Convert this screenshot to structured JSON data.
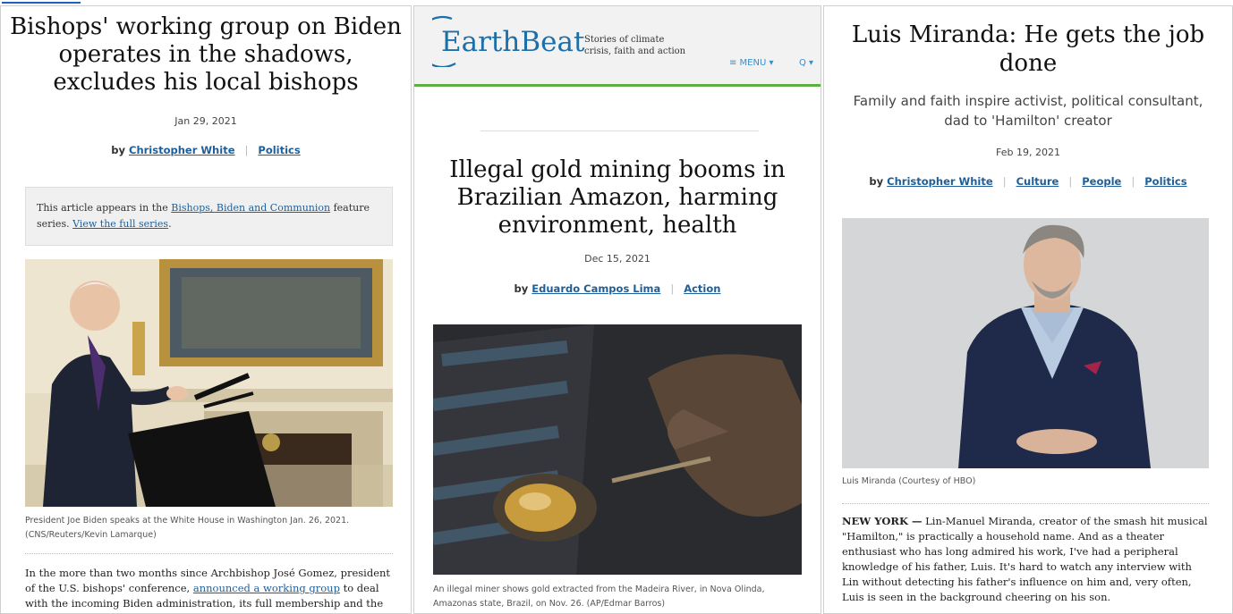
{
  "article1": {
    "headline": "Bishops' working group on Biden operates in the shadows, excludes his local bishops",
    "date": "Jan 29, 2021",
    "by_prefix": "by",
    "author": "Christopher White",
    "sep": "|",
    "category": "Politics",
    "series_text_1": "This article appears in the",
    "series_link": "Bishops, Biden and Communion",
    "series_text_2": "feature series.",
    "view_series": "View the full series",
    "series_period": ".",
    "caption": "President Joe Biden speaks at the White House in Washington Jan. 26, 2021. (CNS/Reuters/Kevin Lamarque)",
    "body_1": "In the more than two months since Archbishop José Gomez, president of the U.S. bishops' conference,",
    "body_link": "announced a working group",
    "body_2": "to deal with the incoming Biden administration, its full membership and the scope of its"
  },
  "article2": {
    "logo_text": "EarthBeat",
    "tagline_1": "Stories of climate",
    "tagline_2": "crisis, faith and action",
    "menu_label": "≡ MENU ▾",
    "search_label": "Q ▾",
    "headline": "Illegal gold mining booms in Brazilian Amazon, harming environment, health",
    "date": "Dec 15, 2021",
    "by_prefix": "by",
    "author": "Eduardo Campos Lima",
    "sep": "|",
    "category": "Action",
    "caption": "An illegal miner shows gold extracted from the Madeira River, in Nova Olinda, Amazonas state, Brazil, on Nov. 26. (AP/Edmar Barros)"
  },
  "article3": {
    "headline": "Luis Miranda: He gets the job done",
    "subhead": "Family and faith inspire activist, political consultant, dad to 'Hamilton' creator",
    "date": "Feb 19, 2021",
    "by_prefix": "by",
    "author": "Christopher White",
    "sep": "|",
    "categories": [
      "Culture",
      "People",
      "Politics"
    ],
    "caption": "Luis Miranda (Courtesy of HBO)",
    "dateline": "NEW YORK —",
    "body": "Lin-Manuel Miranda, creator of the smash hit musical \"Hamilton,\" is practically a household name. And as a theater enthusiast who has long admired his work, I've had a peripheral knowledge of his father, Luis. It's hard to watch any interview with Lin without detecting his father's influence on him and, very often, Luis is seen in the background cheering on his son."
  },
  "colors": {
    "link": "#1f5f99",
    "earthbeat_blue": "#1d6fa8",
    "earthbeat_green": "#5dae45",
    "menu_blue": "#3a8fc8"
  }
}
